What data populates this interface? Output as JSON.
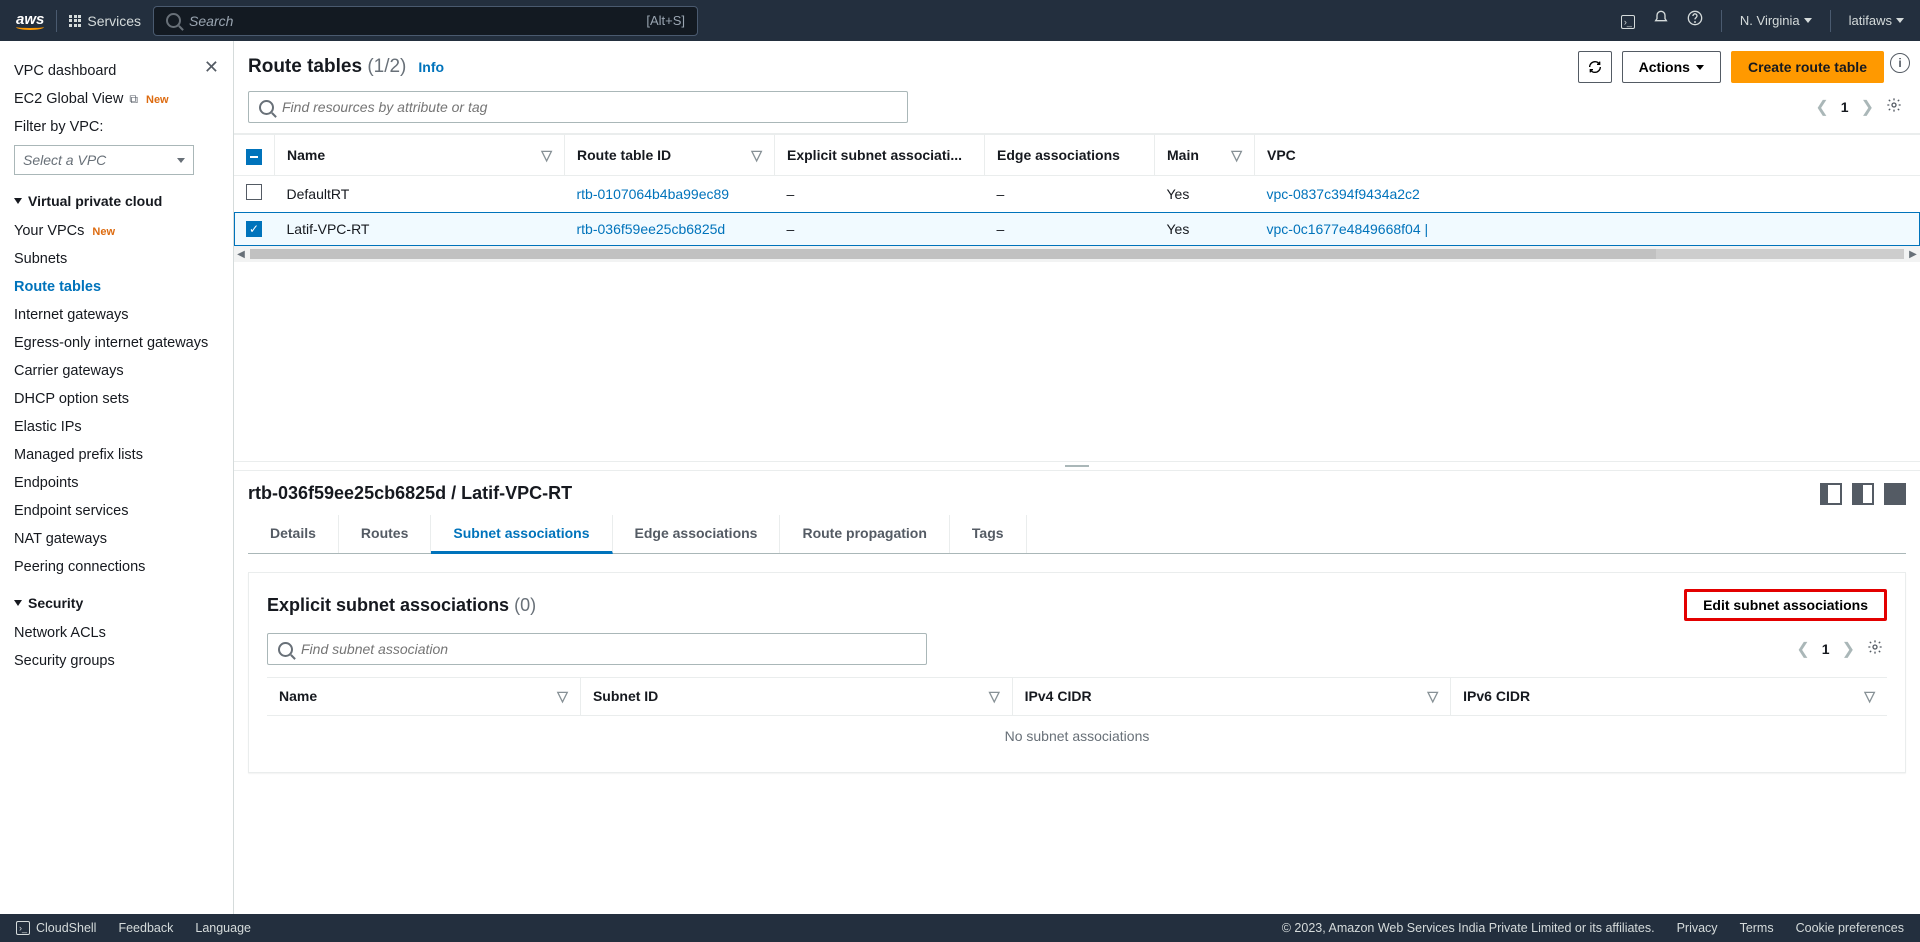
{
  "topnav": {
    "services": "Services",
    "search_placeholder": "Search",
    "search_shortcut": "[Alt+S]",
    "region": "N. Virginia",
    "user": "latifaws"
  },
  "sidebar": {
    "dashboard": "VPC dashboard",
    "ec2_global": "EC2 Global View",
    "new_badge": "New",
    "filter_label": "Filter by VPC:",
    "filter_placeholder": "Select a VPC",
    "section_vpc": {
      "title": "Virtual private cloud",
      "items": [
        "Your VPCs",
        "Subnets",
        "Route tables",
        "Internet gateways",
        "Egress-only internet gateways",
        "Carrier gateways",
        "DHCP option sets",
        "Elastic IPs",
        "Managed prefix lists",
        "Endpoints",
        "Endpoint services",
        "NAT gateways",
        "Peering connections"
      ]
    },
    "section_security": {
      "title": "Security",
      "items": [
        "Network ACLs",
        "Security groups"
      ]
    }
  },
  "header": {
    "title": "Route tables",
    "count": "(1/2)",
    "info": "Info",
    "actions": "Actions",
    "create": "Create route table"
  },
  "filter": {
    "placeholder": "Find resources by attribute or tag",
    "page": "1"
  },
  "columns": [
    "Name",
    "Route table ID",
    "Explicit subnet associati...",
    "Edge associations",
    "Main",
    "VPC"
  ],
  "rows": [
    {
      "selected": false,
      "name": "DefaultRT",
      "rtid": "rtb-0107064b4ba99ec89",
      "explicit": "–",
      "edge": "–",
      "main": "Yes",
      "vpc": "vpc-0837c394f9434a2c2"
    },
    {
      "selected": true,
      "name": "Latif-VPC-RT",
      "rtid": "rtb-036f59ee25cb6825d",
      "explicit": "–",
      "edge": "–",
      "main": "Yes",
      "vpc": "vpc-0c1677e4849668f04 |"
    }
  ],
  "detail": {
    "title": "rtb-036f59ee25cb6825d / Latif-VPC-RT",
    "tabs": [
      "Details",
      "Routes",
      "Subnet associations",
      "Edge associations",
      "Route propagation",
      "Tags"
    ],
    "active_tab": 2,
    "card": {
      "title": "Explicit subnet associations",
      "count": "(0)",
      "edit_btn": "Edit subnet associations",
      "filter_placeholder": "Find subnet association",
      "page": "1",
      "columns": [
        "Name",
        "Subnet ID",
        "IPv4 CIDR",
        "IPv6 CIDR"
      ],
      "empty": "No subnet associations"
    }
  },
  "footer": {
    "cloudshell": "CloudShell",
    "feedback": "Feedback",
    "language": "Language",
    "copyright": "© 2023, Amazon Web Services India Private Limited or its affiliates.",
    "privacy": "Privacy",
    "terms": "Terms",
    "cookies": "Cookie preferences"
  }
}
